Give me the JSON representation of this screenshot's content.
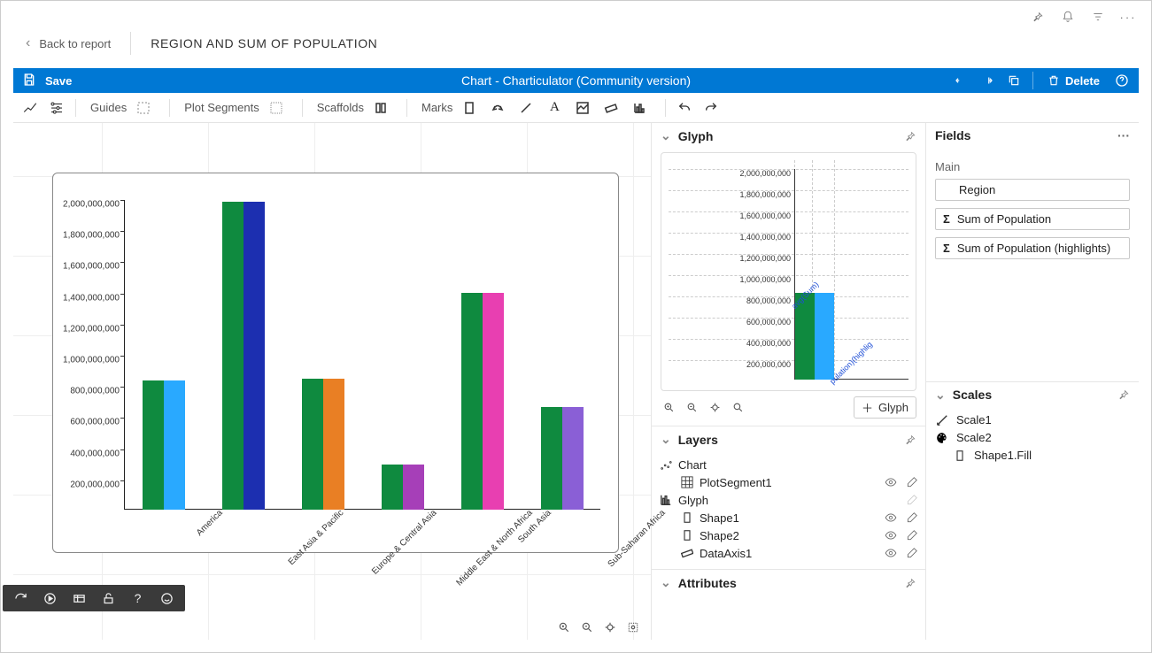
{
  "header": {
    "back_label": "Back to report",
    "page_title": "REGION AND SUM OF POPULATION"
  },
  "bluebar": {
    "save_label": "Save",
    "center_title": "Chart - Charticulator (Community version)",
    "delete_label": "Delete"
  },
  "toolbar": {
    "guides_label": "Guides",
    "plot_segments_label": "Plot Segments",
    "scaffolds_label": "Scaffolds",
    "marks_label": "Marks"
  },
  "glyph_panel": {
    "title": "Glyph",
    "ticks": [
      "2,000,000,000",
      "1,800,000,000",
      "1,600,000,000",
      "1,400,000,000",
      "1,200,000,000",
      "1,000,000,000",
      "800,000,000",
      "600,000,000",
      "400,000,000",
      "200,000,000"
    ],
    "add_label": "Glyph",
    "tilt1": "avg(Sum)",
    "tilt2": "pulation)(highlig"
  },
  "layers_panel": {
    "title": "Layers",
    "chart": "Chart",
    "plotseg": "PlotSegment1",
    "glyph": "Glyph",
    "shape1": "Shape1",
    "shape2": "Shape2",
    "dataaxis": "DataAxis1"
  },
  "attributes_panel": {
    "title": "Attributes"
  },
  "fields_panel": {
    "title": "Fields",
    "main_label": "Main",
    "pill_region": "Region",
    "pill_sumpop": "Sum of Population",
    "pill_sumpop_hl": "Sum of Population (highlights)"
  },
  "scales_panel": {
    "title": "Scales",
    "scale1": "Scale1",
    "scale2": "Scale2",
    "shape1fill": "Shape1.Fill"
  },
  "chart_data": {
    "type": "bar",
    "title": "",
    "xlabel": "",
    "ylabel": "",
    "ylim": [
      0,
      2000000000
    ],
    "y_ticks": [
      "200,000,000",
      "400,000,000",
      "600,000,000",
      "800,000,000",
      "1,000,000,000",
      "1,200,000,000",
      "1,400,000,000",
      "1,600,000,000",
      "1,800,000,000",
      "2,000,000,000"
    ],
    "categories": [
      "America",
      "East Asia & Pacific",
      "Europe & Central Asia",
      "Middle East & North Africa",
      "South Asia",
      "Sub-Saharan Africa"
    ],
    "series": [
      {
        "name": "Shape1",
        "values": [
          830000000,
          1980000000,
          840000000,
          290000000,
          1390000000,
          660000000
        ]
      },
      {
        "name": "Shape2",
        "values": [
          830000000,
          1980000000,
          840000000,
          290000000,
          1390000000,
          660000000
        ]
      }
    ],
    "colors_shape2": [
      "#29a9ff",
      "#1c2fb0",
      "#e97f24",
      "#a63fb8",
      "#e83fb1",
      "#8a5fd6"
    ],
    "color_shape1": "#0f8a3f"
  }
}
